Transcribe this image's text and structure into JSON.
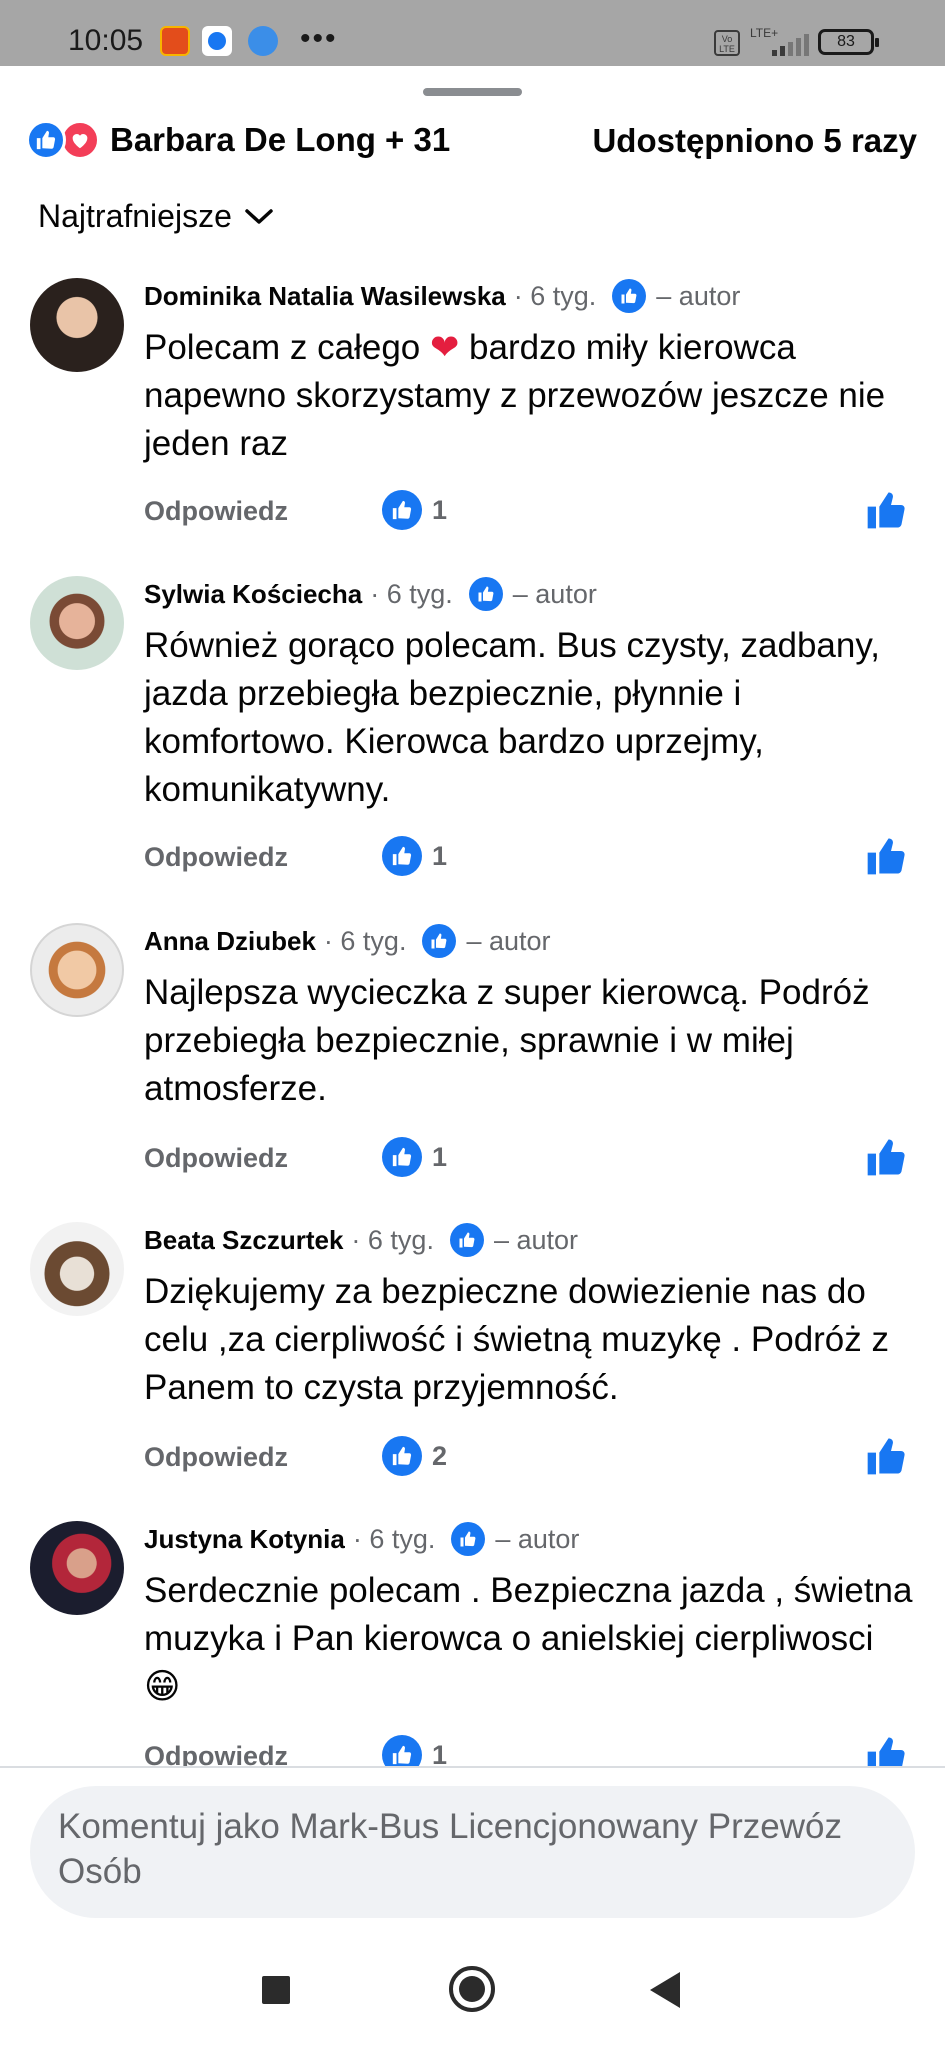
{
  "status_bar": {
    "time": "10:05",
    "more": "•••",
    "volte": "Vo LTE",
    "network": "LTE+",
    "battery": "83"
  },
  "header": {
    "reactions": [
      "like-icon",
      "love-icon"
    ],
    "reacted_by": "Barbara De Long + 31",
    "shares": "Udostępniono 5 razy"
  },
  "sort": {
    "label": "Najtrafniejsze"
  },
  "comments": [
    {
      "name": "Dominika Natalia Wasilewska",
      "time": "· 6 tyg.",
      "author": "– autor",
      "text_before": "Polecam z całego ",
      "emoji": "❤",
      "text_after": " bardzo miły kierowca napewno skorzystamy z przewozów jeszcze nie jeden raz",
      "reply": "Odpowiedz",
      "likes": "1"
    },
    {
      "name": "Sylwia Kościecha",
      "time": "· 6 tyg.",
      "author": "– autor",
      "text": "Również gorąco polecam. Bus czysty, zadbany, jazda przebiegła bezpiecznie, płynnie i komfortowo. Kierowca bardzo uprzejmy, komunikatywny.",
      "reply": "Odpowiedz",
      "likes": "1"
    },
    {
      "name": "Anna Dziubek",
      "time": "· 6 tyg.",
      "author": "– autor",
      "text": "Najlepsza wycieczka z super kierowcą. Podróż przebiegła bezpiecznie, sprawnie i w miłej atmosferze.",
      "reply": "Odpowiedz",
      "likes": "1"
    },
    {
      "name": "Beata Szczurtek",
      "time": "· 6 tyg.",
      "author": "– autor",
      "text": "Dziękujemy za bezpieczne dowiezienie nas do celu ,za cierpliwość i świetną muzykę . Podróż  z Panem  to czysta przyjemność.",
      "reply": "Odpowiedz",
      "likes": "2"
    },
    {
      "name": "Justyna Kotynia",
      "time": "· 6 tyg.",
      "author": "– autor",
      "text": "Serdecznie polecam . Bezpieczna jazda , świetna muzyka i Pan kierowca o anielskiej cierpliwosci ",
      "emoji": "😁",
      "reply": "Odpowiedz",
      "likes": "1"
    }
  ],
  "composer": {
    "placeholder": "Komentuj jako Mark-Bus Licencjonowany Przewóz Osób"
  },
  "colors": {
    "accent": "#1877f2",
    "love": "#f33e58",
    "secondary_text": "#65676b"
  }
}
